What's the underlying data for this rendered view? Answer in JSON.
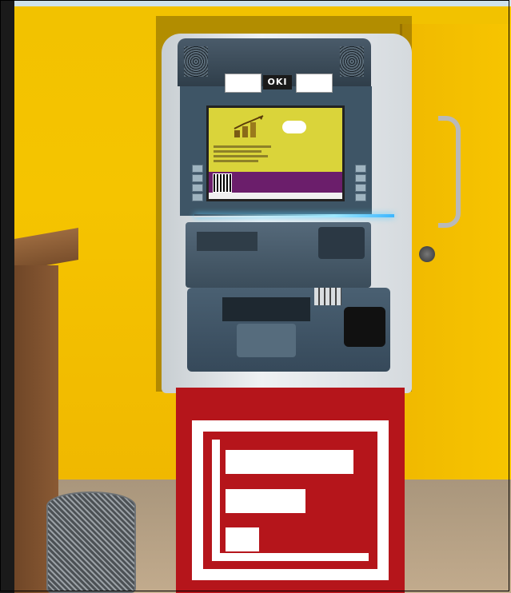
{
  "photo": {
    "brand_label": "OKI",
    "sticker_left": "",
    "sticker_right": ""
  },
  "colors": {
    "wall": "#f5c400",
    "atm_trim": "#3e5566",
    "cabinet": "#b5151b",
    "screen": "#dad43a",
    "led": "#3cb6ff"
  }
}
